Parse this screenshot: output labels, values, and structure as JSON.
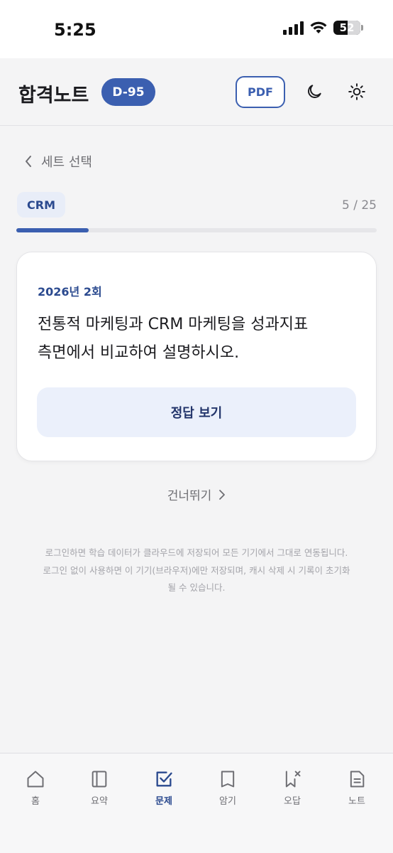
{
  "status": {
    "time": "5:25",
    "battery": "52"
  },
  "header": {
    "title": "합격노트",
    "dday": "D-95",
    "pdf_label": "PDF"
  },
  "back": {
    "label": "세트 선택"
  },
  "category": {
    "chip": "CRM",
    "counter": "5 / 25",
    "progress": 0.2
  },
  "card": {
    "round": "2026년 2회",
    "question_line1": "전통적 마케팅과 CRM 마케팅을 성과지표",
    "question_line2": "측면에서 비교하여 설명하시오.",
    "answer_button": "정답 보기"
  },
  "skip": {
    "label": "건너뛰기"
  },
  "notice": {
    "line1": "로그인하면 학습 데이터가 클라우드에 저장되어 모든 기기에서 그대로 연동됩니다.",
    "line2": "로그인 없이 사용하면 이 기기(브라우저)에만 저장되며, 캐시 삭제 시 기록이 초기화",
    "line3": "될 수 있습니다."
  },
  "nav": {
    "items": [
      {
        "label": "홈",
        "icon": "home-icon"
      },
      {
        "label": "요약",
        "icon": "book-icon"
      },
      {
        "label": "문제",
        "icon": "check-square-icon",
        "active": true
      },
      {
        "label": "암기",
        "icon": "card-icon"
      },
      {
        "label": "오답",
        "icon": "bookmark-x-icon"
      },
      {
        "label": "노트",
        "icon": "note-icon"
      }
    ]
  },
  "colors": {
    "accent": "#3b5fb0",
    "background": "#f4f4f5"
  }
}
